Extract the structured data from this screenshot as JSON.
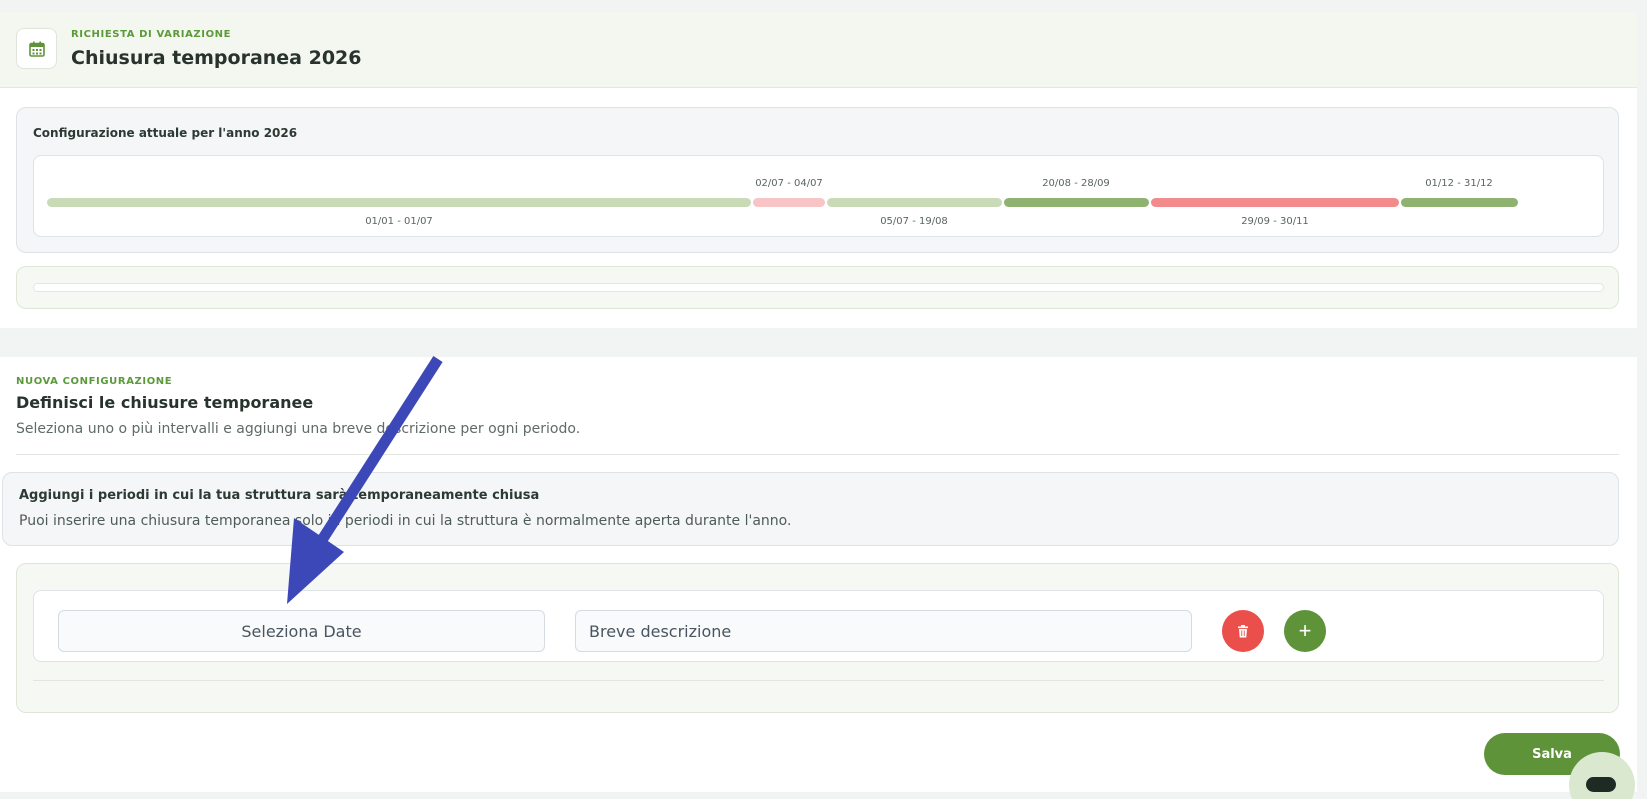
{
  "request": {
    "eyebrow": "RICHIESTA DI VARIAZIONE",
    "title": "Chiusura temporanea 2026",
    "icon": "calendar-icon"
  },
  "current_config": {
    "title": "Configurazione attuale per l'anno 2026",
    "segments": [
      {
        "label": "01/01 - 01/07",
        "status": "open",
        "color": "#c9dbb6",
        "label_pos": "below"
      },
      {
        "label": "02/07 - 04/07",
        "status": "temporary-closure",
        "color": "#f7c5c5",
        "label_pos": "above"
      },
      {
        "label": "05/07 - 19/08",
        "status": "open",
        "color": "#c9dbb6",
        "label_pos": "below"
      },
      {
        "label": "20/08 - 28/09",
        "status": "open-highlight",
        "color": "#8fb270",
        "label_pos": "above"
      },
      {
        "label": "29/09 - 30/11",
        "status": "closed",
        "color": "#f28b8b",
        "label_pos": "below"
      },
      {
        "label": "01/12 - 31/12",
        "status": "open-highlight",
        "color": "#8fb270",
        "label_pos": "above"
      }
    ]
  },
  "new_config": {
    "eyebrow": "NUOVA CONFIGURAZIONE",
    "title": "Definisci le chiusure temporanee",
    "description": "Seleziona uno o più intervalli e aggiungi una breve descrizione per ogni periodo."
  },
  "info": {
    "title": "Aggiungi i periodi in cui la tua struttura sarà temporaneamente chiusa",
    "description": "Puoi inserire una chiusura temporanea solo in periodi in cui la struttura è normalmente aperta durante l'anno."
  },
  "form": {
    "date_placeholder": "Seleziona Date",
    "description_placeholder": "Breve descrizione",
    "delete_icon": "trash-icon",
    "add_icon": "plus-icon",
    "add_symbol": "+"
  },
  "save_label": "Salva",
  "colors": {
    "accent_green": "#5e9339",
    "delete_red": "#ea4f4c",
    "annotation_arrow": "#3d48b8"
  }
}
